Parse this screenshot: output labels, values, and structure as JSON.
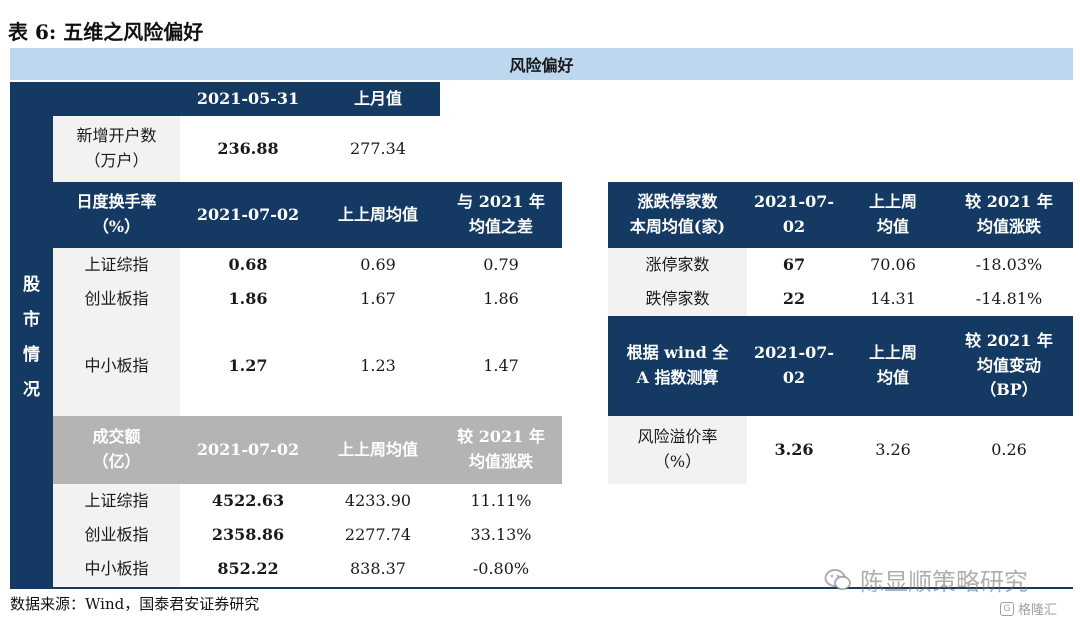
{
  "title": "表 6:  五维之风险偏好",
  "band": "风险偏好",
  "side_label": [
    "股",
    "市",
    "情",
    "况"
  ],
  "accounts": {
    "headers": [
      "2021-05-31",
      "上月值"
    ],
    "row": {
      "label": [
        "新增开户数",
        "（万户）"
      ],
      "current": "236.88",
      "prev": "277.34"
    }
  },
  "turnover": {
    "headers": [
      [
        "日度换手率",
        "（%）"
      ],
      [
        "2021-07-02"
      ],
      [
        "上上周均值"
      ],
      [
        "与 2021 年",
        "均值之差"
      ]
    ],
    "rows": [
      {
        "label": "上证综指",
        "v1": "0.68",
        "v2": "0.69",
        "v3": "0.79"
      },
      {
        "label": "创业板指",
        "v1": "1.86",
        "v2": "1.67",
        "v3": "1.86"
      },
      {
        "label": "中小板指",
        "v1": "1.27",
        "v2": "1.23",
        "v3": "1.47"
      }
    ]
  },
  "volume": {
    "headers": [
      [
        "成交额",
        "（亿）"
      ],
      [
        "2021-07-02"
      ],
      [
        "上上周均值"
      ],
      [
        "较 2021 年",
        "均值涨跌"
      ]
    ],
    "rows": [
      {
        "label": "上证综指",
        "v1": "4522.63",
        "v2": "4233.90",
        "v3": "11.11%"
      },
      {
        "label": "创业板指",
        "v1": "2358.86",
        "v2": "2277.74",
        "v3": "33.13%"
      },
      {
        "label": "中小板指",
        "v1": "852.22",
        "v2": "838.37",
        "v3": "-0.80%"
      }
    ]
  },
  "limit": {
    "headers": [
      [
        "涨跌停家数",
        "本周均值(家)"
      ],
      [
        "2021-07-",
        "02"
      ],
      [
        "上上周",
        "均值"
      ],
      [
        "较 2021 年",
        "均值涨跌"
      ]
    ],
    "rows": [
      {
        "label": "涨停家数",
        "v1": "67",
        "v2": "70.06",
        "v3": "-18.03%"
      },
      {
        "label": "跌停家数",
        "v1": "22",
        "v2": "14.31",
        "v3": "-14.81%"
      }
    ]
  },
  "premium": {
    "headers": [
      [
        "根据 wind 全",
        "A 指数测算"
      ],
      [
        "2021-07-",
        "02"
      ],
      [
        "上上周",
        "均值"
      ],
      [
        "较 2021 年",
        "均值变动",
        "（BP）"
      ]
    ],
    "row": {
      "label": [
        "风险溢价率",
        "（%）"
      ],
      "v1": "3.26",
      "v2": "3.26",
      "v3": "0.26"
    }
  },
  "source": "数据来源：Wind，国泰君安证券研究",
  "watermark": {
    "text": "陈显顺策略研究",
    "logo": "格隆汇",
    "logo_icon": "G"
  },
  "colors": {
    "navy": "#143a63",
    "light_blue": "#bcd7ee",
    "grey": "#b4b4b4"
  }
}
